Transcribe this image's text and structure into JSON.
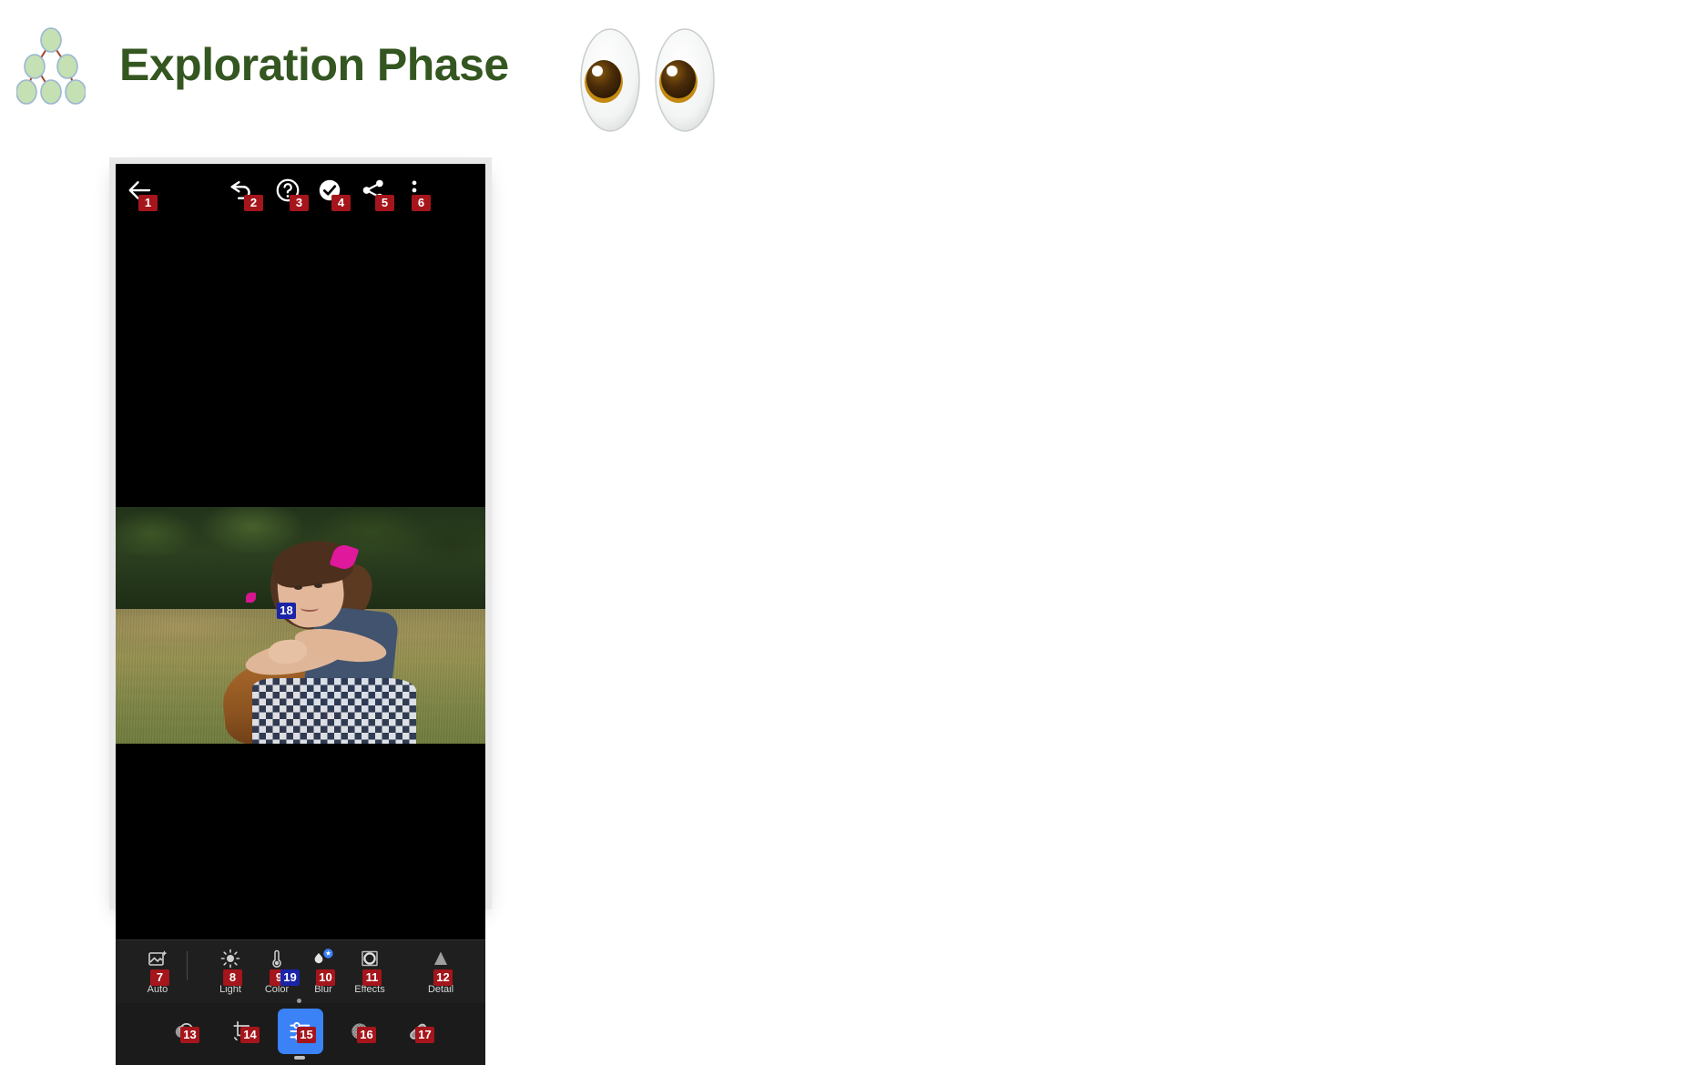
{
  "header": {
    "title": "Exploration Phase",
    "title_color": "#345620",
    "logo_icon": "tree-graph-icon",
    "eyes_icon": "eyes-emoji"
  },
  "phone": {
    "app": "photo-editor",
    "topbar": {
      "items": [
        {
          "name": "back-button",
          "icon": "back-arrow-icon",
          "badge": "1"
        },
        {
          "name": "undo-button",
          "icon": "undo-arrow-icon",
          "badge": "2"
        },
        {
          "name": "help-button",
          "icon": "question-circle-icon",
          "badge": "3"
        },
        {
          "name": "confirm-button",
          "icon": "check-circle-icon",
          "badge": "4"
        },
        {
          "name": "share-button",
          "icon": "share-icon",
          "badge": "5"
        },
        {
          "name": "more-button",
          "icon": "more-vertical-icon",
          "badge": "6"
        }
      ]
    },
    "canvas": {
      "photo_description": "girl with pink bow leaning on wooden chair in a field",
      "badge": "18"
    },
    "tool_strip": {
      "items": [
        {
          "name": "tool-auto",
          "label": "Auto",
          "icon": "auto-enhance-icon",
          "badge": "7"
        },
        {
          "name": "tool-light",
          "label": "Light",
          "icon": "sun-icon",
          "badge": "8"
        },
        {
          "name": "tool-color",
          "label": "Color",
          "icon": "thermometer-icon",
          "badge": "9"
        },
        {
          "name": "tool-blur",
          "label": "Blur",
          "icon": "blur-drop-icon",
          "badge": "10",
          "badge_secondary": "19"
        },
        {
          "name": "tool-effects",
          "label": "Effects",
          "icon": "vignette-icon",
          "badge": "11"
        },
        {
          "name": "tool-detail",
          "label": "Detail",
          "icon": "triangle-icon",
          "badge": "12"
        }
      ]
    },
    "bottom_nav": {
      "items": [
        {
          "name": "nav-selective",
          "icon": "mask-circles-icon",
          "badge": "13",
          "selected": false
        },
        {
          "name": "nav-crop",
          "icon": "crop-rotate-icon",
          "badge": "14",
          "selected": false
        },
        {
          "name": "nav-adjust",
          "icon": "sliders-icon",
          "badge": "15",
          "selected": true
        },
        {
          "name": "nav-retouch",
          "icon": "dotted-circle-icon",
          "badge": "16",
          "selected": false
        },
        {
          "name": "nav-heal",
          "icon": "bandage-icon",
          "badge": "17",
          "selected": false
        }
      ]
    }
  },
  "colors": {
    "badge_red": "#a5151b",
    "badge_blue": "#1b23a8",
    "accent_blue": "#3b82f6",
    "title_green": "#345620"
  }
}
